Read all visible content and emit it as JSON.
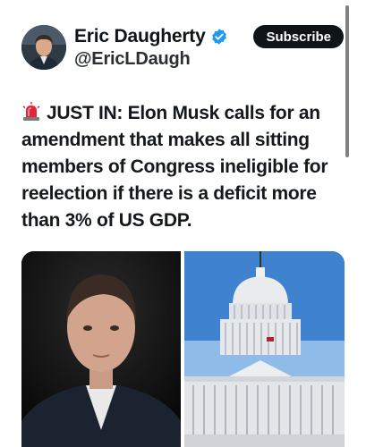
{
  "author": {
    "display_name": "Eric Daugherty",
    "handle": "@EricLDaugh",
    "verified_icon": "verified-badge-icon",
    "avatar_icon": "avatar"
  },
  "subscribe_label": "Subscribe",
  "tweet": {
    "emoji": "siren-icon",
    "text": "JUST IN: Elon Musk calls for an amendment that makes all sitting members of Congress ineligible for reelection if there is a deficit more than 3% of US GDP."
  },
  "media": {
    "images": [
      "portrait-photo",
      "capitol-building-photo"
    ]
  },
  "colors": {
    "text": "#0f1419",
    "verified": "#1d9bf0",
    "button": "#0f1419"
  }
}
